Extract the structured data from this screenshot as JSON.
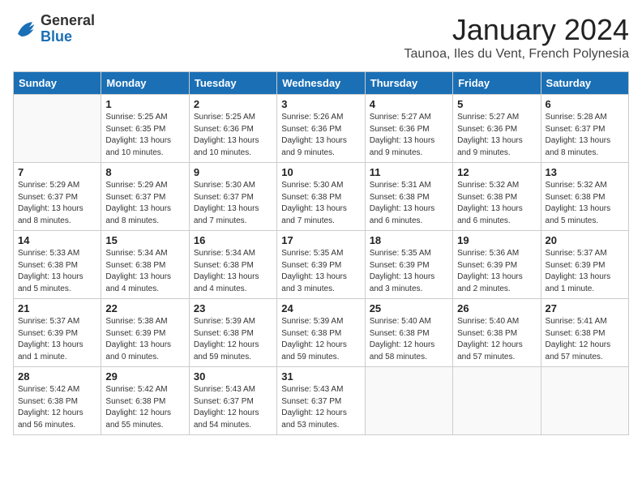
{
  "header": {
    "logo_general": "General",
    "logo_blue": "Blue",
    "month_title": "January 2024",
    "location": "Taunoa, Iles du Vent, French Polynesia"
  },
  "days_of_week": [
    "Sunday",
    "Monday",
    "Tuesday",
    "Wednesday",
    "Thursday",
    "Friday",
    "Saturday"
  ],
  "weeks": [
    [
      {
        "num": "",
        "info": ""
      },
      {
        "num": "1",
        "info": "Sunrise: 5:25 AM\nSunset: 6:35 PM\nDaylight: 13 hours\nand 10 minutes."
      },
      {
        "num": "2",
        "info": "Sunrise: 5:25 AM\nSunset: 6:36 PM\nDaylight: 13 hours\nand 10 minutes."
      },
      {
        "num": "3",
        "info": "Sunrise: 5:26 AM\nSunset: 6:36 PM\nDaylight: 13 hours\nand 9 minutes."
      },
      {
        "num": "4",
        "info": "Sunrise: 5:27 AM\nSunset: 6:36 PM\nDaylight: 13 hours\nand 9 minutes."
      },
      {
        "num": "5",
        "info": "Sunrise: 5:27 AM\nSunset: 6:36 PM\nDaylight: 13 hours\nand 9 minutes."
      },
      {
        "num": "6",
        "info": "Sunrise: 5:28 AM\nSunset: 6:37 PM\nDaylight: 13 hours\nand 8 minutes."
      }
    ],
    [
      {
        "num": "7",
        "info": "Sunrise: 5:29 AM\nSunset: 6:37 PM\nDaylight: 13 hours\nand 8 minutes."
      },
      {
        "num": "8",
        "info": "Sunrise: 5:29 AM\nSunset: 6:37 PM\nDaylight: 13 hours\nand 8 minutes."
      },
      {
        "num": "9",
        "info": "Sunrise: 5:30 AM\nSunset: 6:37 PM\nDaylight: 13 hours\nand 7 minutes."
      },
      {
        "num": "10",
        "info": "Sunrise: 5:30 AM\nSunset: 6:38 PM\nDaylight: 13 hours\nand 7 minutes."
      },
      {
        "num": "11",
        "info": "Sunrise: 5:31 AM\nSunset: 6:38 PM\nDaylight: 13 hours\nand 6 minutes."
      },
      {
        "num": "12",
        "info": "Sunrise: 5:32 AM\nSunset: 6:38 PM\nDaylight: 13 hours\nand 6 minutes."
      },
      {
        "num": "13",
        "info": "Sunrise: 5:32 AM\nSunset: 6:38 PM\nDaylight: 13 hours\nand 5 minutes."
      }
    ],
    [
      {
        "num": "14",
        "info": "Sunrise: 5:33 AM\nSunset: 6:38 PM\nDaylight: 13 hours\nand 5 minutes."
      },
      {
        "num": "15",
        "info": "Sunrise: 5:34 AM\nSunset: 6:38 PM\nDaylight: 13 hours\nand 4 minutes."
      },
      {
        "num": "16",
        "info": "Sunrise: 5:34 AM\nSunset: 6:38 PM\nDaylight: 13 hours\nand 4 minutes."
      },
      {
        "num": "17",
        "info": "Sunrise: 5:35 AM\nSunset: 6:39 PM\nDaylight: 13 hours\nand 3 minutes."
      },
      {
        "num": "18",
        "info": "Sunrise: 5:35 AM\nSunset: 6:39 PM\nDaylight: 13 hours\nand 3 minutes."
      },
      {
        "num": "19",
        "info": "Sunrise: 5:36 AM\nSunset: 6:39 PM\nDaylight: 13 hours\nand 2 minutes."
      },
      {
        "num": "20",
        "info": "Sunrise: 5:37 AM\nSunset: 6:39 PM\nDaylight: 13 hours\nand 1 minute."
      }
    ],
    [
      {
        "num": "21",
        "info": "Sunrise: 5:37 AM\nSunset: 6:39 PM\nDaylight: 13 hours\nand 1 minute."
      },
      {
        "num": "22",
        "info": "Sunrise: 5:38 AM\nSunset: 6:39 PM\nDaylight: 13 hours\nand 0 minutes."
      },
      {
        "num": "23",
        "info": "Sunrise: 5:39 AM\nSunset: 6:38 PM\nDaylight: 12 hours\nand 59 minutes."
      },
      {
        "num": "24",
        "info": "Sunrise: 5:39 AM\nSunset: 6:38 PM\nDaylight: 12 hours\nand 59 minutes."
      },
      {
        "num": "25",
        "info": "Sunrise: 5:40 AM\nSunset: 6:38 PM\nDaylight: 12 hours\nand 58 minutes."
      },
      {
        "num": "26",
        "info": "Sunrise: 5:40 AM\nSunset: 6:38 PM\nDaylight: 12 hours\nand 57 minutes."
      },
      {
        "num": "27",
        "info": "Sunrise: 5:41 AM\nSunset: 6:38 PM\nDaylight: 12 hours\nand 57 minutes."
      }
    ],
    [
      {
        "num": "28",
        "info": "Sunrise: 5:42 AM\nSunset: 6:38 PM\nDaylight: 12 hours\nand 56 minutes."
      },
      {
        "num": "29",
        "info": "Sunrise: 5:42 AM\nSunset: 6:38 PM\nDaylight: 12 hours\nand 55 minutes."
      },
      {
        "num": "30",
        "info": "Sunrise: 5:43 AM\nSunset: 6:37 PM\nDaylight: 12 hours\nand 54 minutes."
      },
      {
        "num": "31",
        "info": "Sunrise: 5:43 AM\nSunset: 6:37 PM\nDaylight: 12 hours\nand 53 minutes."
      },
      {
        "num": "",
        "info": ""
      },
      {
        "num": "",
        "info": ""
      },
      {
        "num": "",
        "info": ""
      }
    ]
  ]
}
